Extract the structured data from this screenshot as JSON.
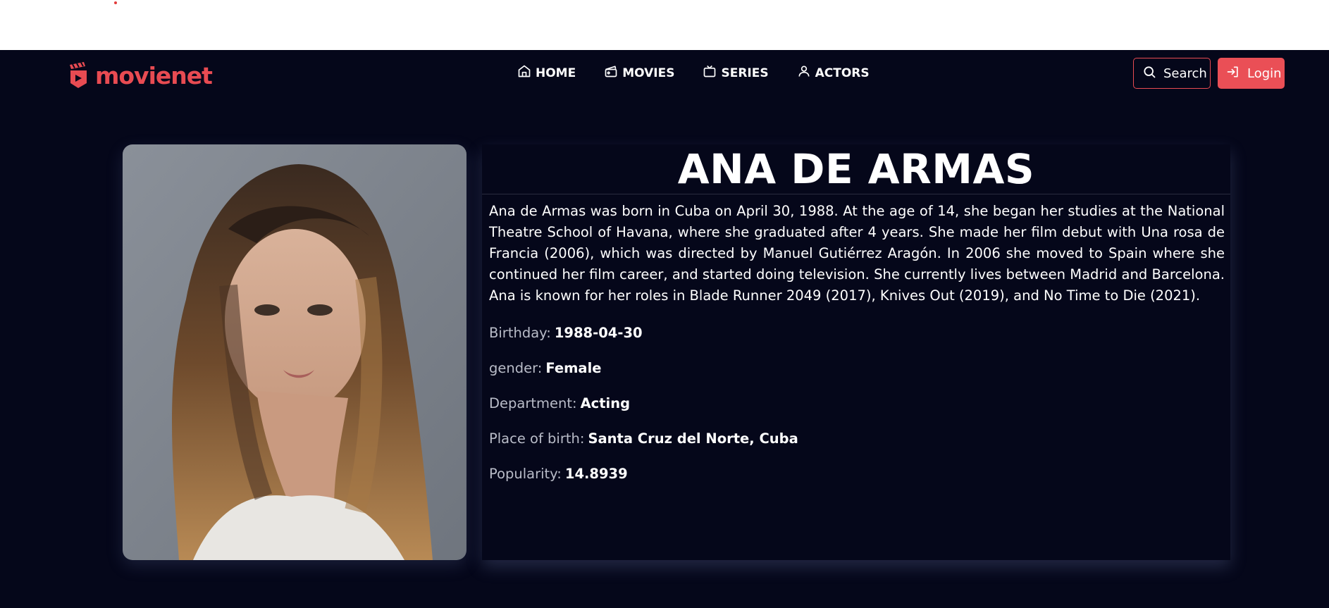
{
  "brand": {
    "name": "movienet",
    "accent": "#e84b52"
  },
  "nav": [
    {
      "label": "HOME",
      "icon": "home-icon"
    },
    {
      "label": "MOVIES",
      "icon": "film-reel-icon"
    },
    {
      "label": "SERIES",
      "icon": "tv-icon"
    },
    {
      "label": "ACTORS",
      "icon": "user-icon"
    }
  ],
  "actions": {
    "search_label": "Search",
    "login_label": "Login"
  },
  "actor": {
    "name": "ANA DE ARMAS",
    "bio": "Ana de Armas was born in Cuba on April 30, 1988. At the age of 14, she began her studies at the National Theatre School of Havana, where she graduated after 4 years. She made her film debut with Una rosa de Francia (2006), which was directed by Manuel Gutiérrez Aragón. In 2006 she moved to Spain where she continued her film career, and started doing television. She currently lives between Madrid and Barcelona. Ana is known for her roles in Blade Runner 2049 (2017), Knives Out (2019), and No Time to Die (2021).",
    "fields": [
      {
        "label": "Birthday:",
        "value": "1988-04-30"
      },
      {
        "label": "gender:",
        "value": "Female"
      },
      {
        "label": "Department:",
        "value": "Acting"
      },
      {
        "label": "Place of birth:",
        "value": "Santa Cruz del Norte, Cuba"
      },
      {
        "label": "Popularity:",
        "value": "14.8939"
      }
    ]
  },
  "colors": {
    "background": "#05071a",
    "accent": "#ea4f56",
    "muted_text": "#b9bcc8"
  }
}
